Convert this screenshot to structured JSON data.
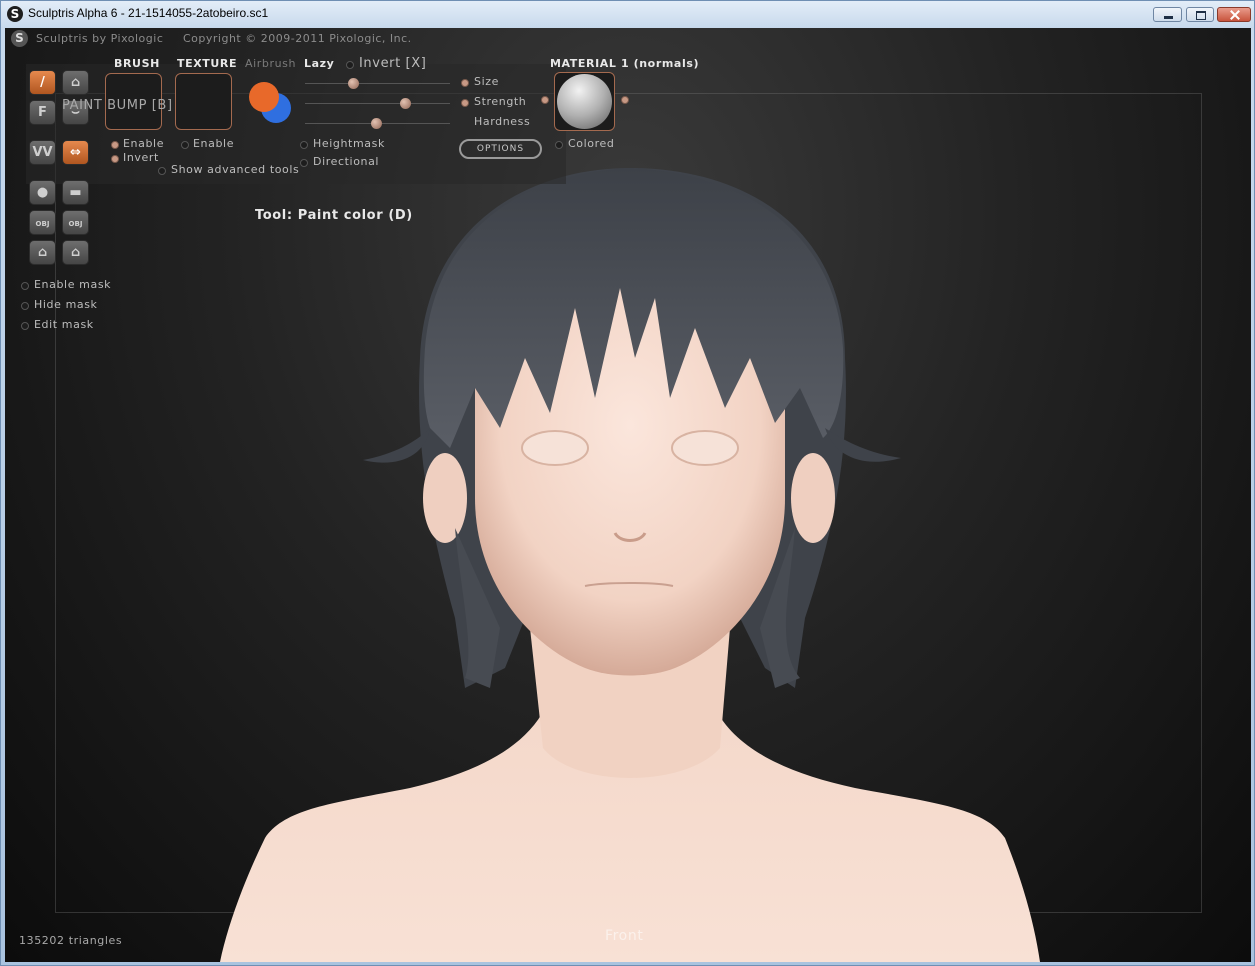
{
  "window": {
    "title": "Sculptris Alpha 6 - 21-1514055-2atobeiro.sc1",
    "app_icon": "S"
  },
  "viewport": {
    "credit_app": "Sculptris by Pixologic",
    "credit_copyright": "Copyright © 2009-2011 Pixologic, Inc.",
    "tool_label": "Tool: Paint color (D)",
    "triangle_count": "135202 triangles",
    "view_name": "Front"
  },
  "paint_panel": {
    "brush_heading": "BRUSH",
    "texture_heading": "TEXTURE",
    "airbrush_label": "Airbrush",
    "lazy_label": "Lazy",
    "invert_x_label": "Invert [X]",
    "paint_bump_label": "PAINT BUMP [B]",
    "brush_enable_label": "Enable",
    "brush_invert_label": "Invert",
    "texture_enable_label": "Enable",
    "show_advanced_label": "Show advanced tools",
    "size_label": "Size",
    "strength_label": "Strength",
    "hardness_label": "Hardness",
    "heightmask_label": "Heightmask",
    "directional_label": "Directional",
    "options_label": "OPTIONS",
    "material_heading": "MATERIAL 1 (normals)",
    "colored_label": "Colored",
    "primary_color": "#e8692a",
    "secondary_color": "#2f6fe0"
  },
  "left_toolbar": {
    "f_button": "F",
    "obj_import": "OBJ",
    "obj_export": "OBJ",
    "mask_enable": "Enable mask",
    "mask_hide": "Hide mask",
    "mask_edit": "Edit mask"
  }
}
